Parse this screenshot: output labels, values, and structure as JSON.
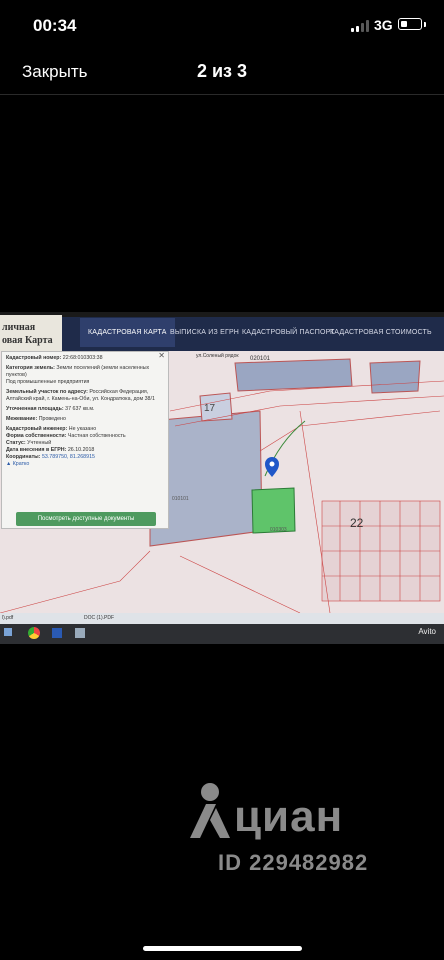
{
  "status_bar": {
    "time": "00:34",
    "network": "3G",
    "signal_bars": 2,
    "battery_level": 0.35
  },
  "top_bar": {
    "close_label": "Закрыть",
    "counter": "2 из 3"
  },
  "photo": {
    "site_title_line1": "личная",
    "site_title_line2": "овая Карта",
    "nav": [
      "КАДАСТРОВАЯ КАРТА",
      "ВЫПИСКА ИЗ ЕГРН",
      "КАДАСТРОВЫЙ ПАСПОРТ",
      "КАДАСТРОВАЯ СТОИМОСТЬ"
    ],
    "map_labels": [
      "ул.Соленый рядок",
      "020101",
      "17",
      "22",
      "010101",
      "010303"
    ],
    "panel": {
      "cad_number_label": "Кадастровый номер:",
      "cad_number": "22:68:010303:38",
      "category_label": "Категория земель:",
      "category": "Земли поселений (земли населенных пунктов)",
      "use": "Под промышленные предприятия",
      "address_label": "Земельный участок по адресу:",
      "address": "Российская Федерация, Алтайский край, г. Камень-на-Оби, ул. Кондратюка, дом 38/1",
      "area_label": "Уточненная площадь:",
      "area": "37 637 кв.м.",
      "survey_label": "Межевание:",
      "survey": "Проведено",
      "engineer_label": "Кадастровый инженер:",
      "engineer": "Не указано",
      "ownership_label": "Форма собственности:",
      "ownership": "Частная собственность",
      "status_label": "Статус:",
      "status": "Учтенный",
      "date_label": "Дата внесения в ЕГРН:",
      "date": "26.10.2018",
      "coords_label": "Координаты:",
      "coords": "53.789750, 81.268915",
      "collapse": "▲ Кратко",
      "docs_button": "Посмотреть доступные документы"
    },
    "downloads": [
      "l).pdf",
      "DOC (1).PDF"
    ],
    "avito": "Avito"
  },
  "watermark": {
    "brand": "циан",
    "id": "ID 229482982"
  }
}
